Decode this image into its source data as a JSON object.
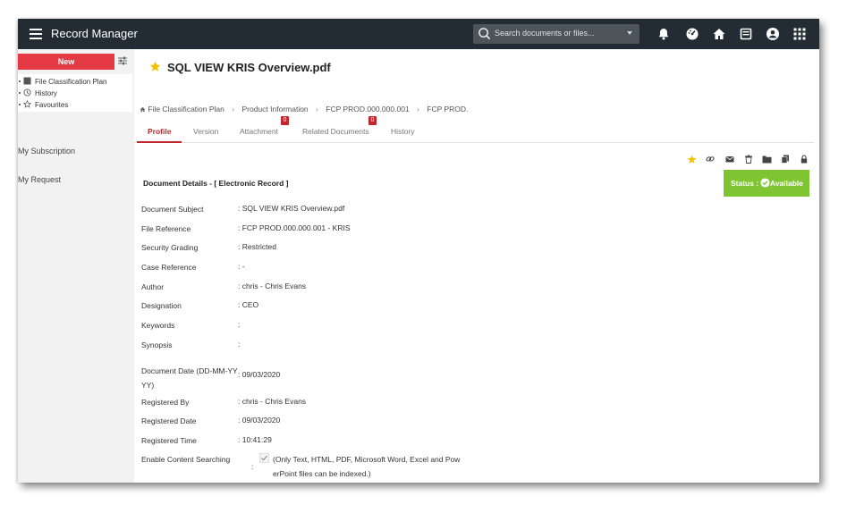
{
  "app": {
    "title": "Record Manager"
  },
  "search": {
    "placeholder": "Search documents or files..."
  },
  "topbar_icons": [
    "bell-icon",
    "dashboard-icon",
    "home-icon",
    "inbox-icon",
    "user-icon",
    "apps-grid-icon"
  ],
  "sidebar": {
    "new_label": "New",
    "tree": [
      {
        "label": "File Classification Plan",
        "icon": "folder-icon"
      },
      {
        "label": "History",
        "icon": "history-icon"
      },
      {
        "label": "Favourites",
        "icon": "star-outline-icon"
      }
    ],
    "links": [
      "My Subscription",
      "My Request"
    ]
  },
  "document": {
    "title": "SQL VIEW KRIS Overview.pdf",
    "breadcrumb": [
      "File Classification Plan",
      "Product Information",
      "FCP PROD.000.000.001",
      "FCP PROD."
    ],
    "tabs": [
      {
        "label": "Profile",
        "active": true
      },
      {
        "label": "Version"
      },
      {
        "label": "Attachment",
        "badge": "0"
      },
      {
        "label": "Related Documents",
        "badge": "0"
      },
      {
        "label": "History"
      }
    ],
    "actions": [
      "star-icon",
      "link-icon",
      "mail-icon",
      "trash-icon",
      "folder-open-icon",
      "copy-icon",
      "lock-icon",
      "edit-icon"
    ],
    "section_title": "Document Details - [ Electronic Record ]",
    "status_label": "Status :",
    "status_value": "Available",
    "fields": [
      {
        "label": "Document Subject",
        "value": ": SQL VIEW KRIS Overview.pdf"
      },
      {
        "label": "File Reference",
        "value": ": FCP PROD.000.000.001 - KRIS"
      },
      {
        "label": "Security Grading",
        "value": ": Restricted"
      },
      {
        "label": "Case Reference",
        "value": ": -"
      },
      {
        "label": "Author",
        "value": ": chris - Chris Evans"
      },
      {
        "label": "Designation",
        "value": ": CEO"
      },
      {
        "label": "Keywords",
        "value": ":"
      },
      {
        "label": "Synopsis",
        "value": ":"
      },
      {
        "label": "Document Date (DD-MM-YYYY)",
        "value": ": 09/03/2020"
      },
      {
        "label": "Registered By",
        "value": ": chris - Chris Evans"
      },
      {
        "label": "Registered Date",
        "value": ": 09/03/2020"
      },
      {
        "label": "Registered Time",
        "value": ": 10:41:29"
      },
      {
        "label": "Enable Content Searching",
        "value": ":"
      }
    ],
    "content_search_note": "(Only Text, HTML, PDF, Microsoft Word, Excel and PowerPoint files can be indexed.)"
  },
  "colors": {
    "topbar": "#232c33",
    "new_button": "#e63946",
    "active_tab": "#c0272d",
    "status": "#7ec531",
    "star": "#f2c200"
  }
}
